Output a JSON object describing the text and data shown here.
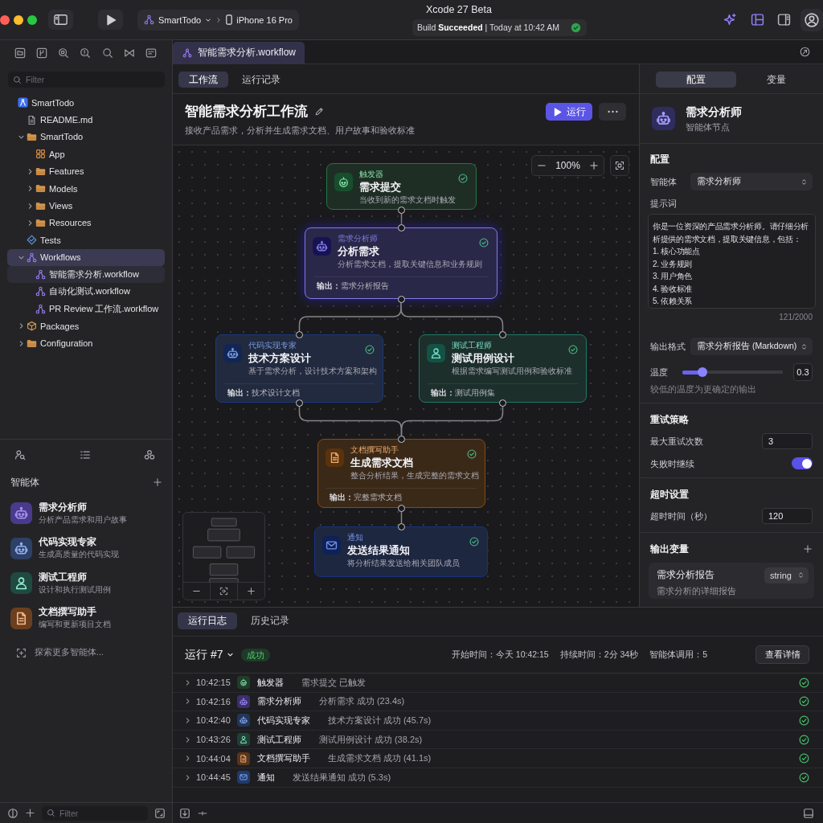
{
  "window": {
    "title": "Xcode 27 Beta"
  },
  "toolbar": {
    "scheme": "SmartTodo",
    "destination": "iPhone 16 Pro",
    "build_status": "Build **Succeeded** | Today at 10:42 AM",
    "build_succeeded": true
  },
  "navigator": {
    "filter": {
      "placeholder": "Filter"
    },
    "tree": [
      {
        "label": "SmartTodo",
        "kind": "project",
        "selected": false,
        "current": false,
        "children": [
          {
            "label": "README.md",
            "kind": "file",
            "selected": false,
            "current": false
          },
          {
            "label": "SmartTodo",
            "kind": "folder",
            "expanded": true,
            "selected": false,
            "current": false,
            "children": [
              {
                "label": "App",
                "kind": "app",
                "selected": false,
                "current": false
              },
              {
                "label": "Features",
                "kind": "folder",
                "expanded": false,
                "selected": false,
                "current": false
              },
              {
                "label": "Models",
                "kind": "folder",
                "expanded": false,
                "selected": false,
                "current": false
              },
              {
                "label": "Views",
                "kind": "folder",
                "expanded": false,
                "selected": false,
                "current": false
              },
              {
                "label": "Resources",
                "kind": "folder",
                "expanded": false,
                "selected": false,
                "current": false
              }
            ]
          },
          {
            "label": "Tests",
            "kind": "tests",
            "selected": false,
            "current": false
          },
          {
            "label": "Workflows",
            "kind": "workflows",
            "expanded": true,
            "selected": true,
            "current": false,
            "children": [
              {
                "label": "智能需求分析.workflow",
                "kind": "workflow",
                "selected": false,
                "current": true
              },
              {
                "label": "自动化测试.workflow",
                "kind": "workflow",
                "selected": false,
                "current": false
              },
              {
                "label": "PR Review 工作流.workflow",
                "kind": "workflow",
                "selected": false,
                "current": false
              }
            ]
          },
          {
            "label": "Packages",
            "kind": "package",
            "expanded": false,
            "selected": false,
            "current": false
          },
          {
            "label": "Configuration",
            "kind": "folder",
            "expanded": false,
            "selected": false,
            "current": false
          }
        ]
      }
    ]
  },
  "agents": {
    "title": "智能体",
    "items": [
      {
        "name": "需求分析师",
        "description": "分析产品需求和用户故事",
        "kind": "analyst",
        "color": "#4a3a8c"
      },
      {
        "name": "代码实现专家",
        "description": "生成高质量的代码实现",
        "kind": "developer",
        "color": "#2d4068"
      },
      {
        "name": "测试工程师",
        "description": "设计和执行测试用例",
        "kind": "tester",
        "color": "#1f4a3f"
      },
      {
        "name": "文档撰写助手",
        "description": "编写和更新项目文档",
        "kind": "writer",
        "color": "#6b3f1e"
      }
    ],
    "explore": "探索更多智能体..."
  },
  "navigator_footer": {
    "filter": {
      "placeholder": "Filter"
    }
  },
  "editor": {
    "tab": "智能需求分析.workflow",
    "view_tabs": [
      {
        "label": "工作流",
        "selected": true
      },
      {
        "label": "运行记录",
        "selected": false
      }
    ],
    "title": "智能需求分析工作流",
    "description": "接收产品需求，分析并生成需求文档、用户故事和验收标准",
    "run_button": "运行"
  },
  "canvas": {
    "zoom": "100%",
    "nodes": [
      {
        "kind": "trigger",
        "role": "触发器",
        "title": "需求提交",
        "description": "当收到新的需求文档时触发",
        "color": "#1f2e25",
        "selected": false,
        "completed": true
      },
      {
        "kind": "analyst",
        "role": "需求分析师",
        "title": "分析需求",
        "description": "分析需求文档，提取关键信息和业务规则",
        "output": "**输出：**需求分析报告",
        "color": "#2a2848",
        "selected": true,
        "completed": true
      },
      {
        "kind": "developer",
        "role": "代码实现专家",
        "title": "技术方案设计",
        "description": "基于需求分析，设计技术方案和架构",
        "output": "**输出：**技术设计文档",
        "color": "#212a3e",
        "selected": false,
        "completed": true
      },
      {
        "kind": "tester",
        "role": "测试工程师",
        "title": "测试用例设计",
        "description": "根据需求编写测试用例和验收标准",
        "output": "**输出：**测试用例集",
        "color": "#1c2f2b",
        "selected": false,
        "completed": true
      },
      {
        "kind": "writer",
        "role": "文档撰写助手",
        "title": "生成需求文档",
        "description": "整合分析结果，生成完整的需求文档",
        "output": "**输出：**完整需求文档",
        "color": "#3b2918",
        "selected": false,
        "completed": true
      },
      {
        "kind": "notification",
        "role": "通知",
        "title": "发送结果通知",
        "description": "将分析结果发送给相关团队成员",
        "color": "#1e2740",
        "selected": false,
        "completed": true
      }
    ]
  },
  "inspector": {
    "tabs": [
      {
        "label": "配置",
        "selected": true
      },
      {
        "label": "变量",
        "selected": false
      }
    ],
    "node": {
      "title": "需求分析师",
      "subtitle": "智能体节点"
    },
    "sections": [
      {
        "title": "配置",
        "kind": "fields",
        "fields": [
          {
            "kind": "select",
            "label": "智能体",
            "value": "需求分析师"
          },
          {
            "kind": "textarea",
            "label": "提示词",
            "lines": [
              "你是一位资深的产品需求分析师。请仔细分析",
              "析提供的需求文档，提取关键信息，包括：",
              "1. 核心功能点",
              "2. 业务规则",
              "3. 用户角色",
              "4. 验收标准",
              "5. 依赖关系"
            ],
            "counter": "121/2000"
          },
          {
            "kind": "select",
            "label": "输出格式",
            "value": "需求分析报告 (Markdown)"
          },
          {
            "kind": "slider",
            "label": "温度",
            "level": 0.2,
            "value": "0.3",
            "hint": "较低的温度为更确定的输出"
          }
        ]
      },
      {
        "title": "重试策略",
        "kind": "fields",
        "fields": [
          {
            "kind": "number",
            "label": "最大重试次数",
            "value": "3"
          },
          {
            "kind": "toggle",
            "label": "失败时继续",
            "on": true
          }
        ]
      },
      {
        "title": "超时设置",
        "kind": "fields",
        "fields": [
          {
            "kind": "number",
            "label": "超时时间（秒）",
            "value": "120"
          }
        ]
      },
      {
        "title": "输出变量",
        "kind": "variables",
        "variables": [
          {
            "name": "需求分析报告",
            "type": "string",
            "description": "需求分析的详细报告"
          }
        ]
      }
    ]
  },
  "run_panel": {
    "tabs": [
      {
        "label": "运行日志",
        "selected": true
      },
      {
        "label": "历史记录",
        "selected": false
      }
    ],
    "run": "运行 #7",
    "status": {
      "kind": "success",
      "label": "成功"
    },
    "meta": [
      "开始时间：今天 10:42:15",
      "持续时间：2分 34秒",
      "智能体调用：5"
    ],
    "details_button": "查看详情",
    "log": [
      {
        "time": "10:42:15",
        "agent": "触发器",
        "message": "需求提交 已触发",
        "kind": "trigger",
        "color": "#1f3d2a",
        "expanded": false,
        "completed": true
      },
      {
        "time": "10:42:16",
        "agent": "需求分析师",
        "message": "分析需求 成功 (23.4s)",
        "kind": "analyst",
        "color": "#3b2f70",
        "expanded": false,
        "completed": true
      },
      {
        "time": "10:42:40",
        "agent": "代码实现专家",
        "message": "技术方案设计 成功 (45.7s)",
        "kind": "developer",
        "color": "#23365a",
        "expanded": false,
        "completed": true
      },
      {
        "time": "10:43:26",
        "agent": "测试工程师",
        "message": "测试用例设计 成功 (38.2s)",
        "kind": "tester",
        "color": "#1f4034",
        "expanded": false,
        "completed": true
      },
      {
        "time": "10:44:04",
        "agent": "文档撰写助手",
        "message": "生成需求文档 成功 (41.1s)",
        "kind": "writer",
        "color": "#5a3519",
        "expanded": false,
        "completed": true
      },
      {
        "time": "10:44:45",
        "agent": "通知",
        "message": "发送结果通知 成功 (5.3s)",
        "kind": "notification",
        "color": "#213a6b",
        "expanded": false,
        "completed": true
      }
    ]
  }
}
